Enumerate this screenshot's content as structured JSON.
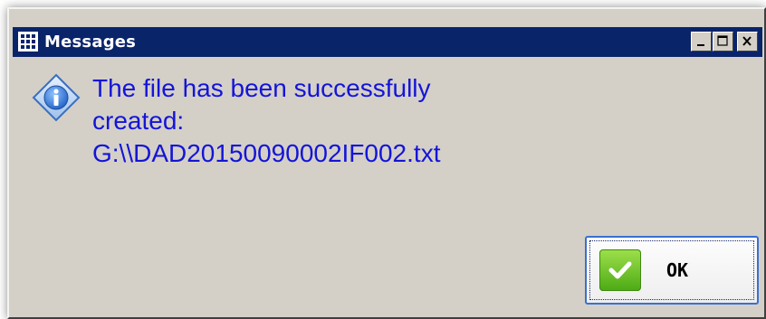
{
  "window": {
    "title": "Messages",
    "icon": "app-grid-icon",
    "controls": {
      "minimize": "minimize-icon",
      "maximize": "maximize-icon",
      "close": "close-icon"
    }
  },
  "dialog": {
    "icon": "info-icon",
    "message": " The file has been successfully\ncreated:\nG:\\\\DAD20150090002IF002.txt",
    "message_color": "#1414d8"
  },
  "buttons": {
    "ok_label": "OK",
    "ok_icon": "checkmark-icon",
    "ok_icon_color": "#5bbf1f"
  },
  "colors": {
    "titlebar": "#0a246a",
    "dialog_background": "#d4d0c8"
  }
}
